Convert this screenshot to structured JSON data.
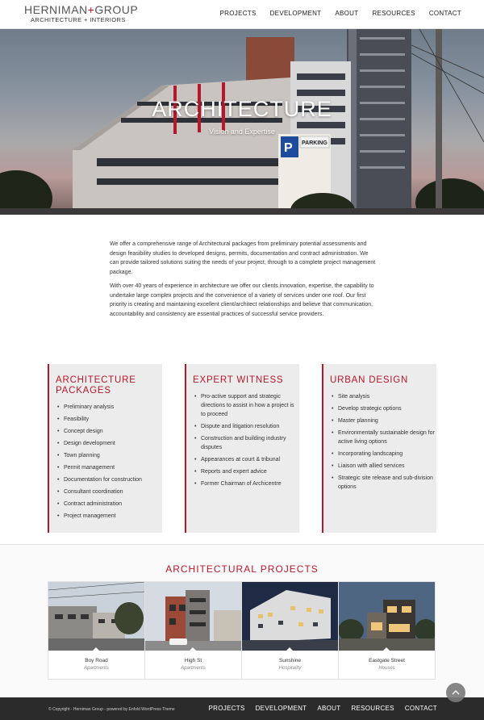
{
  "header": {
    "logo_main": "HERNIMAN",
    "logo_plus": "+",
    "logo_group": "GROUP",
    "logo_sub": "ARCHITECTURE + INTERIORS",
    "nav": [
      "PROJECTS",
      "DEVELOPMENT",
      "ABOUT",
      "RESOURCES",
      "CONTACT"
    ]
  },
  "hero": {
    "title": "ARCHITECTURE",
    "subtitle": "Vision and Expertise",
    "sign_parking": "PARKING"
  },
  "intro": {
    "p1": "We offer a comprehensive range of Architectural packages from preliminary potential assessments and design feasibility studies to developed designs, permits, documentation and contract administration. We can provide tailored solutions suiting the needs of your project, through to a complete project management package.",
    "p2": "With over 40 years of experience in architecture we offer our clients innovation, expertise, the capability to undertake large complex projects and the convenience of a variety of services under one roof. Our first priority is creating and maintaining excellent client/architect relationships and believe that communication, accountability and consistency are essential practices of successful service providers."
  },
  "cards": [
    {
      "title": "ARCHITECTURE PACKAGES",
      "items": [
        "Preliminary analysis",
        "Feasibility",
        "Concept design",
        "Design development",
        "Town planning",
        "Permit management",
        "Documentation for construction",
        "Consultant coordination",
        "Contract administration",
        "Project management"
      ]
    },
    {
      "title": "EXPERT WITNESS",
      "items": [
        "Pro-active support and strategic directions to assist in how a project is to proceed",
        "Dispute and litigation resolution",
        "Construction and building industry disputes",
        "Appearances at court & tribunal",
        "Reports and expert advice",
        "Former Chairman of Archicentre"
      ]
    },
    {
      "title": "URBAN DESIGN",
      "items": [
        "Site analysis",
        "Develop strategic options",
        "Master planning",
        "Environmentally sustainable design for active living options",
        "Incorporating landscaping",
        "Liaison with allied services",
        "Strategic site release and sub-division options"
      ]
    }
  ],
  "projects": {
    "title": "ARCHITECTURAL PROJECTS",
    "items": [
      {
        "name": "Boy Road",
        "type": "Apartments"
      },
      {
        "name": "High St",
        "type": "Apartments"
      },
      {
        "name": "Sunshine",
        "type": "Hospitality"
      },
      {
        "name": "Eastgate Street",
        "type": "Houses"
      }
    ]
  },
  "footer": {
    "copyright": "© Copyright - Herniman Group - powered by Enfold WordPress Theme",
    "nav": [
      "PROJECTS",
      "DEVELOPMENT",
      "ABOUT",
      "RESOURCES",
      "CONTACT"
    ]
  },
  "colors": {
    "accent": "#b5182b",
    "card_bg": "#ececec",
    "footer_bg": "#2b2b2b"
  },
  "icons": {
    "scroll_top": "chevron-up-icon"
  }
}
